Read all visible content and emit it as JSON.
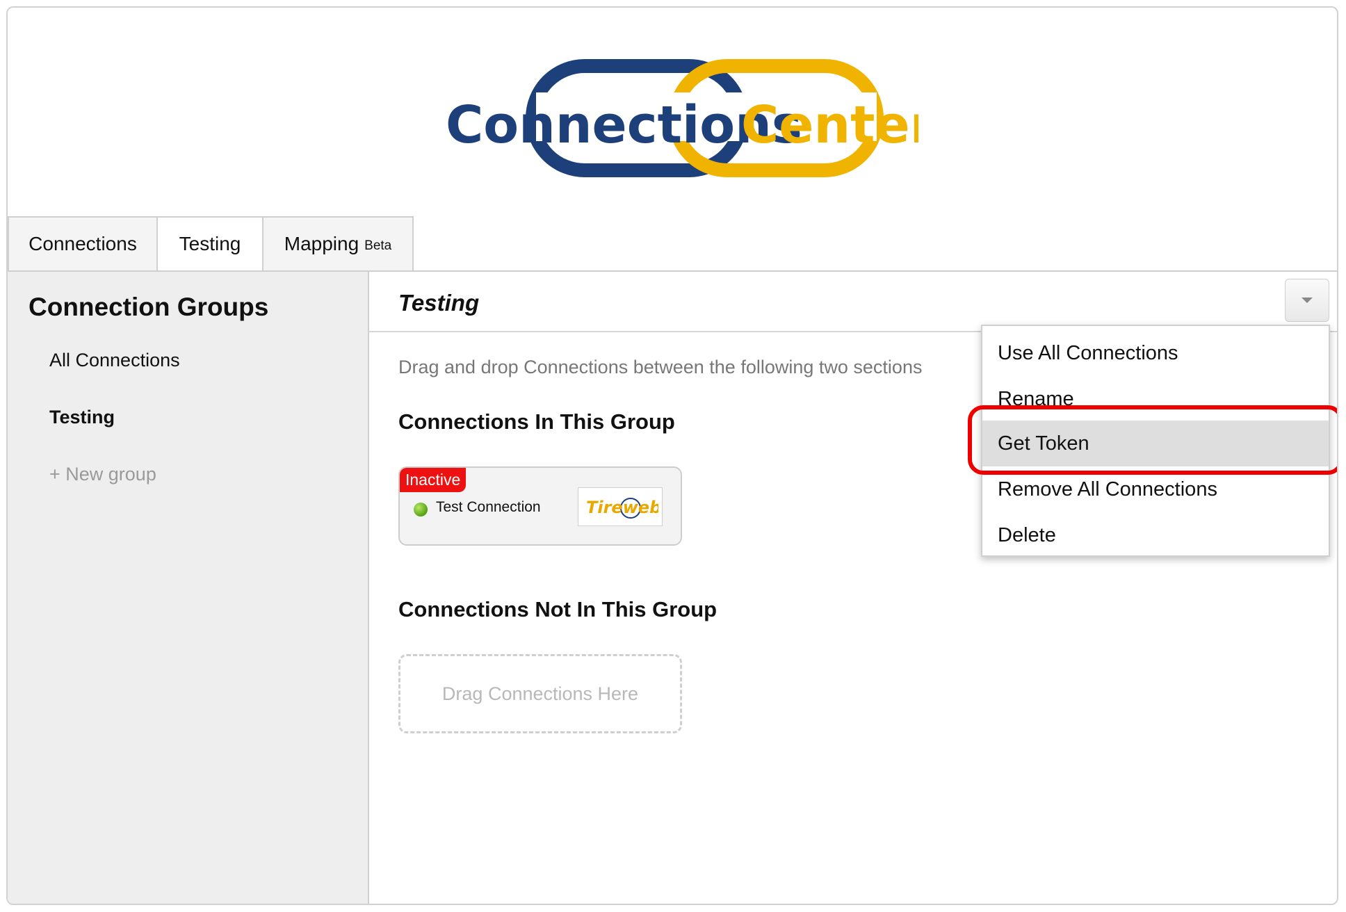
{
  "logo": {
    "text_part1": "Connections",
    "text_part2": "Center",
    "color_blue": "#1d3f7a",
    "color_yellow": "#f0b400"
  },
  "tabs": [
    {
      "label": "Connections"
    },
    {
      "label": "Testing"
    },
    {
      "label": "Mapping",
      "badge": "Beta"
    }
  ],
  "sidebar": {
    "heading": "Connection Groups",
    "items": [
      {
        "label": "All Connections"
      },
      {
        "label": "Testing"
      }
    ],
    "new_group": "+ New group"
  },
  "main": {
    "title": "Testing",
    "hint": "Drag and drop Connections between the following two sections",
    "in_group_title": "Connections In This Group",
    "not_in_group_title": "Connections Not In This Group",
    "connection": {
      "status": "Inactive",
      "name": "Test Connection",
      "logo_text": "Tireweb"
    },
    "drop_zone": "Drag Connections Here"
  },
  "menu": {
    "items": [
      {
        "label": "Use All Connections"
      },
      {
        "label": "Rename"
      },
      {
        "label": "Get Token"
      },
      {
        "label": "Remove All Connections"
      },
      {
        "label": "Delete"
      }
    ],
    "selected": "Get Token"
  },
  "colors": {
    "inactive_badge": "#ee1111",
    "highlight": "#ee0000",
    "status_dot": "#55a012"
  }
}
